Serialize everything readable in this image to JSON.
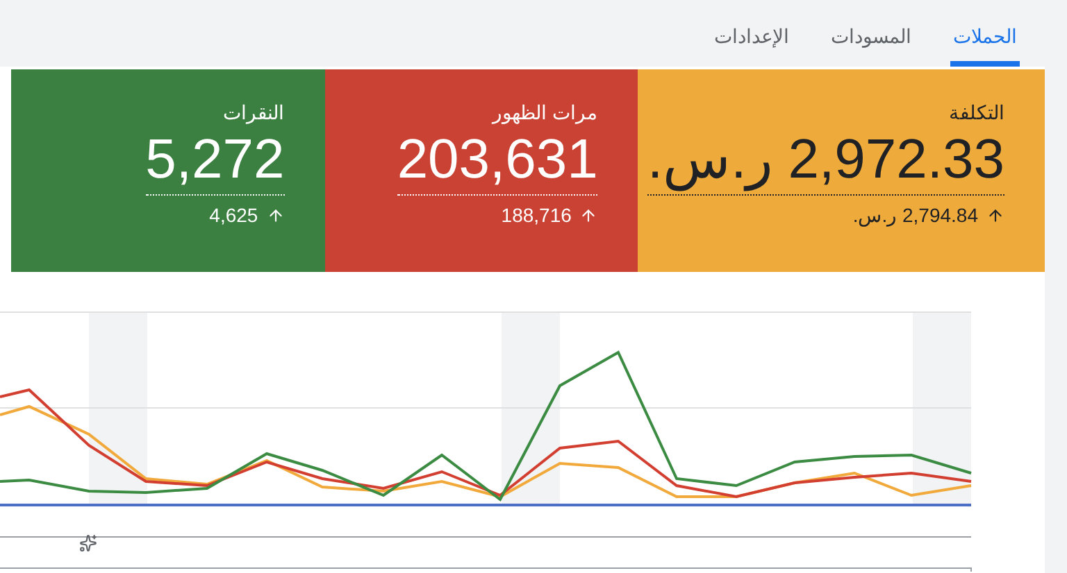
{
  "tabs": [
    {
      "label": "الحملات",
      "selected": true
    },
    {
      "label": "المسودات",
      "selected": false
    },
    {
      "label": "الإعدادات",
      "selected": false
    }
  ],
  "metrics": [
    {
      "label": "التكلفة",
      "value": "2,972.33 ر.س.",
      "previous": "2,794.84 ر.س.",
      "color": "#eeab3b"
    },
    {
      "label": "مرات الظهور",
      "value": "203,631",
      "previous": "188,716",
      "color": "#c94234"
    },
    {
      "label": "النقرات",
      "value": "5,272",
      "previous": "4,625",
      "color": "#3b7f41"
    }
  ]
}
